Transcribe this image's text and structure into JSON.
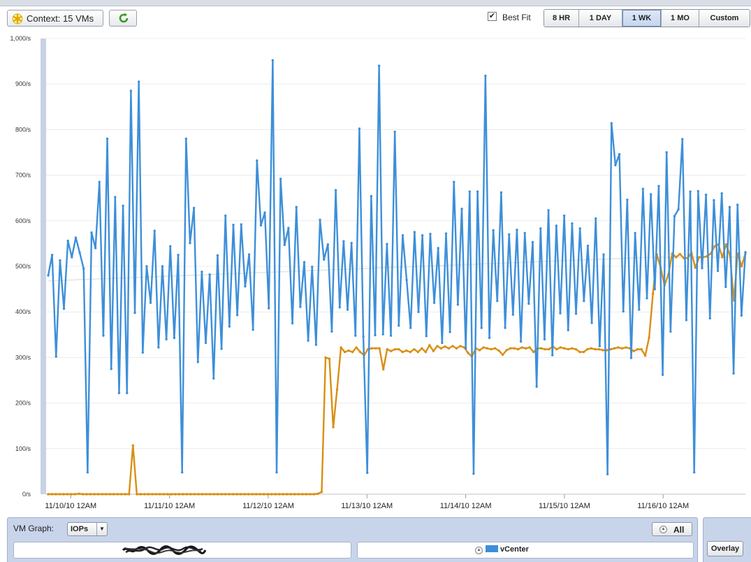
{
  "toolbar": {
    "context_label": "Context: 15 VMs",
    "best_fit_label": "Best Fit",
    "best_fit_checked": true,
    "ranges": [
      "8 HR",
      "1 DAY",
      "1 WK",
      "1 MO",
      "Custom"
    ],
    "active_range": "1 WK"
  },
  "chart_data": {
    "type": "line",
    "title": "",
    "xlabel": "",
    "ylabel": "",
    "ylim": [
      0,
      1000
    ],
    "y_ticks": [
      "0/s",
      "100/s",
      "200/s",
      "300/s",
      "400/s",
      "500/s",
      "600/s",
      "700/s",
      "800/s",
      "900/s",
      "1,000/s"
    ],
    "x_ticks": [
      "11/10/10 12AM",
      "11/11/10 12AM",
      "11/12/10 12AM",
      "11/13/10 12AM",
      "11/14/10 12AM",
      "11/15/10 12AM",
      "11/16/10 12AM"
    ],
    "x_start": "11/09/10 6PM",
    "x_end": "11/16/10 8PM",
    "grid": true,
    "series": [
      {
        "name": "vCenter",
        "color": "#3d8fd9",
        "values": [
          480,
          525,
          302,
          513,
          407,
          556,
          520,
          563,
          530,
          495,
          48,
          574,
          540,
          685,
          348,
          780,
          275,
          652,
          222,
          633,
          222,
          885,
          398,
          905,
          311,
          500,
          420,
          578,
          322,
          500,
          340,
          544,
          343,
          525,
          48,
          780,
          551,
          628,
          290,
          488,
          332,
          482,
          254,
          524,
          319,
          611,
          368,
          591,
          393,
          592,
          456,
          526,
          361,
          732,
          590,
          618,
          408,
          952,
          48,
          692,
          547,
          584,
          375,
          630,
          411,
          509,
          337,
          499,
          328,
          602,
          515,
          548,
          357,
          667,
          410,
          555,
          405,
          551,
          348,
          802,
          346,
          47,
          654,
          349,
          940,
          351,
          549,
          348,
          795,
          370,
          568,
          470,
          365,
          575,
          400,
          568,
          347,
          571,
          420,
          540,
          332,
          572,
          356,
          685,
          416,
          626,
          320,
          664,
          45,
          664,
          365,
          918,
          343,
          579,
          424,
          662,
          365,
          570,
          394,
          580,
          335,
          573,
          418,
          553,
          236,
          583,
          340,
          623,
          305,
          589,
          397,
          611,
          360,
          594,
          396,
          583,
          424,
          545,
          376,
          605,
          325,
          526,
          44,
          814,
          722,
          746,
          401,
          646,
          299,
          573,
          405,
          670,
          430,
          658,
          450,
          676,
          262,
          750,
          357,
          610,
          625,
          779,
          382,
          664,
          48,
          665,
          496,
          657,
          386,
          645,
          490,
          660,
          455,
          630,
          265,
          635,
          392,
          531
        ]
      },
      {
        "name": "",
        "color": "#d98f12",
        "values": [
          0,
          0,
          0,
          0,
          0,
          0,
          0,
          0,
          1,
          0,
          0,
          0,
          0,
          0,
          0,
          0,
          0,
          0,
          0,
          0,
          0,
          0,
          107,
          0,
          0,
          0,
          0,
          0,
          0,
          0,
          0,
          0,
          0,
          0,
          0,
          0,
          0,
          0,
          0,
          0,
          0,
          0,
          0,
          0,
          0,
          0,
          0,
          0,
          0,
          0,
          0,
          0,
          0,
          0,
          0,
          0,
          0,
          0,
          0,
          0,
          0,
          0,
          0,
          0,
          0,
          0,
          0,
          0,
          0,
          0,
          1,
          5,
          300,
          297,
          147,
          230,
          322,
          312,
          315,
          312,
          322,
          312,
          305,
          318,
          320,
          320,
          320,
          274,
          318,
          314,
          318,
          318,
          312,
          315,
          312,
          318,
          312,
          320,
          312,
          327,
          314,
          325,
          320,
          324,
          320,
          325,
          320,
          325,
          322,
          310,
          302,
          320,
          316,
          322,
          320,
          318,
          320,
          315,
          306,
          316,
          320,
          320,
          318,
          322,
          320,
          322,
          312,
          320,
          320,
          318,
          318,
          324,
          318,
          322,
          320,
          318,
          320,
          318,
          312,
          312,
          318,
          320,
          318,
          318,
          316,
          316,
          318,
          320,
          322,
          320,
          322,
          320,
          314,
          318,
          318,
          304,
          344,
          440,
          526,
          497,
          458,
          482,
          528,
          520,
          527,
          518,
          518,
          530,
          497,
          520,
          520,
          522,
          528,
          544,
          548,
          520,
          548,
          524,
          425,
          528,
          500,
          528
        ]
      },
      {
        "name": "",
        "color": "#dde6de",
        "values": [
          468,
          470,
          472,
          474,
          476,
          478,
          480,
          482,
          484,
          486,
          488,
          490,
          492,
          494,
          496,
          498,
          500,
          502,
          504,
          506,
          508,
          510,
          512,
          514,
          516,
          518,
          520,
          520,
          520,
          520,
          520
        ]
      }
    ]
  },
  "bottom": {
    "vm_graph_label": "VM Graph:",
    "metric": "IOPs",
    "all_label": "All",
    "vcenter_label": "vCenter",
    "overlay_label": "Overlay"
  }
}
